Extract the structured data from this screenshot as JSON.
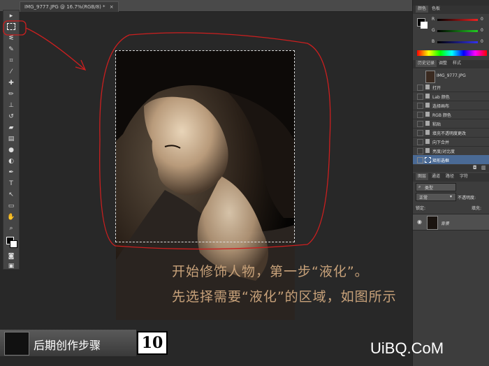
{
  "document_tab": {
    "label": "IMG_9777.JPG @ 16.7%(RGB/8) *",
    "close": "×"
  },
  "color_panel": {
    "tabs": [
      "颜色",
      "色板"
    ],
    "channels": [
      {
        "label": "R",
        "value": "0"
      },
      {
        "label": "G",
        "value": "0"
      },
      {
        "label": "B",
        "value": "0"
      }
    ]
  },
  "history_panel": {
    "tabs": [
      "历史记录",
      "调整",
      "样式"
    ],
    "snapshot": "IMG_9777.JPG",
    "items": [
      "打开",
      "Lab 颜色",
      "选择画布",
      "RGB 颜色",
      "粘贴",
      "填充不透明度更改",
      "向下合并",
      "亮度/对比度",
      "矩形选框"
    ]
  },
  "layers_panel": {
    "tabs": [
      "图层",
      "通道",
      "路径",
      "字符"
    ],
    "filter_label": "类型",
    "blend_mode": "正常",
    "opacity_label": "不透明度:",
    "lock_label": "锁定:",
    "fill_label": "填充:",
    "layer_name": "背景"
  },
  "captions": [
    "开始修饰人物，第一步“液化”。",
    "先选择需要“液化”的区域，如图所示"
  ],
  "badge": {
    "title": "后期创作步骤",
    "number": "10"
  },
  "watermark": "UiBQ.CoM",
  "colors": {
    "annotation": "#cc1f1f",
    "caption": "#c8a27a",
    "highlight": "#4a6a95"
  }
}
